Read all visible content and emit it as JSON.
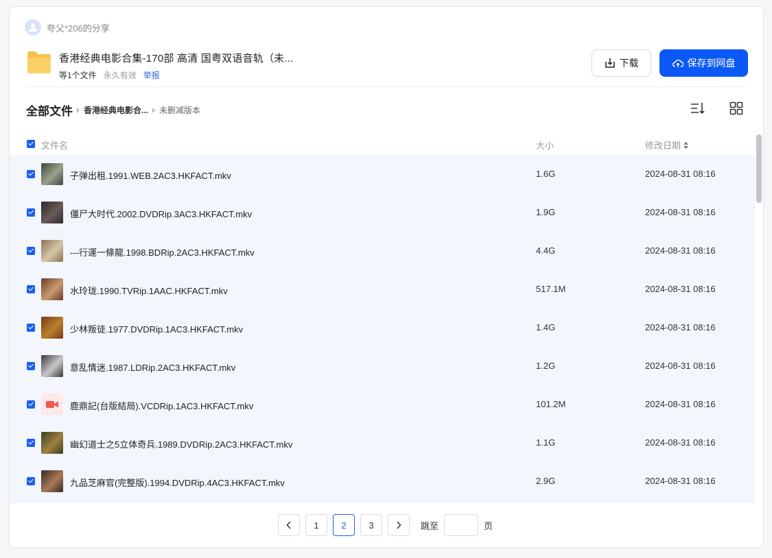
{
  "share": {
    "sharer": "夸父*206的分享",
    "title": "香港经典电影合集-170部 高清 国粤双语音轨（未...",
    "meta_count": "等1个文件",
    "meta_validity": "永久有效",
    "meta_report": "举报",
    "download_label": "下载",
    "save_label": "保存到网盘"
  },
  "breadcrumb": {
    "root": "全部文件",
    "mid": "香港经典电影合...",
    "current": "未删减版本"
  },
  "table": {
    "headers": {
      "name": "文件名",
      "size": "大小",
      "date": "修改日期"
    },
    "rows": [
      {
        "name": "子弹出租.1991.WEB.2AC3.HKFACT.mkv",
        "size": "1.6G",
        "date": "2024-08-31 08:16",
        "thumb": "photo"
      },
      {
        "name": "僵尸大时代.2002.DVDRip.3AC3.HKFACT.mkv",
        "size": "1.9G",
        "date": "2024-08-31 08:16",
        "thumb": "photo"
      },
      {
        "name": "---行運一條龍.1998.BDRip.2AC3.HKFACT.mkv",
        "size": "4.4G",
        "date": "2024-08-31 08:16",
        "thumb": "photo"
      },
      {
        "name": "水玲珑.1990.TVRip.1AAC.HKFACT.mkv",
        "size": "517.1M",
        "date": "2024-08-31 08:16",
        "thumb": "photo"
      },
      {
        "name": "少林叛徒.1977.DVDRip.1AC3.HKFACT.mkv",
        "size": "1.4G",
        "date": "2024-08-31 08:16",
        "thumb": "photo"
      },
      {
        "name": "意乱情迷.1987.LDRip.2AC3.HKFACT.mkv",
        "size": "1.2G",
        "date": "2024-08-31 08:16",
        "thumb": "photo"
      },
      {
        "name": "鹿鼎記(台版結局).VCDRip.1AC3.HKFACT.mkv",
        "size": "101.2M",
        "date": "2024-08-31 08:16",
        "thumb": "video-icon"
      },
      {
        "name": "幽幻道士之5立体奇兵.1989.DVDRip.2AC3.HKFACT.mkv",
        "size": "1.1G",
        "date": "2024-08-31 08:16",
        "thumb": "photo"
      },
      {
        "name": "九品芝麻官(完整版).1994.DVDRip.4AC3.HKFACT.mkv",
        "size": "2.9G",
        "date": "2024-08-31 08:16",
        "thumb": "photo"
      }
    ]
  },
  "pagination": {
    "pages": [
      "1",
      "2",
      "3"
    ],
    "current": "2",
    "jump_label": "跳至",
    "page_label": "页"
  },
  "colors": {
    "accent": "#0a59f7",
    "checkbox": "#1a5ff2",
    "row_selected_bg": "#f3f6fd",
    "folder": "#f8c14a"
  }
}
